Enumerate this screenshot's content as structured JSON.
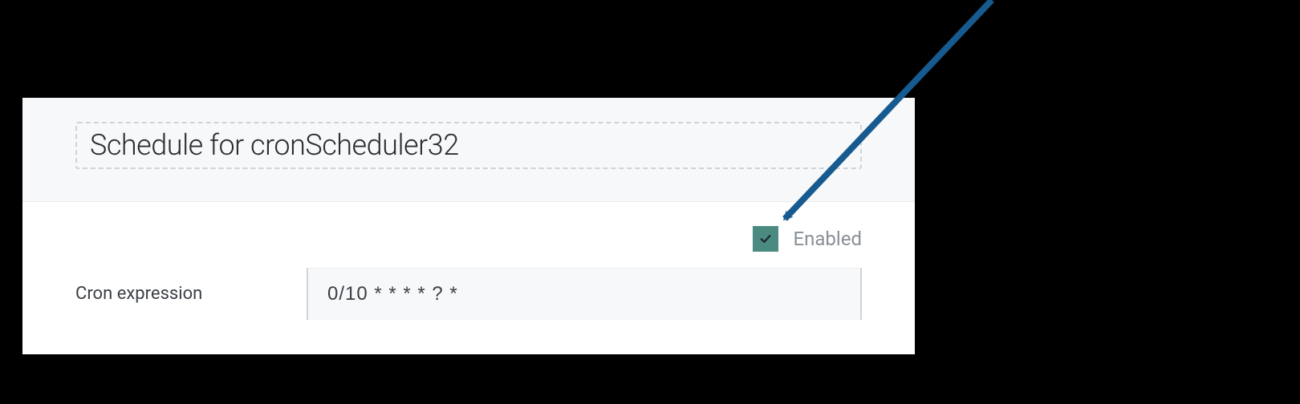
{
  "title": "Schedule for cronScheduler32",
  "enabled": {
    "label": "Enabled",
    "checked": true
  },
  "cron": {
    "label": "Cron expression",
    "value": "0/10 * * * * ? *"
  },
  "colors": {
    "checkbox_bg": "#4a8a81",
    "arrow": "#165a8f"
  }
}
